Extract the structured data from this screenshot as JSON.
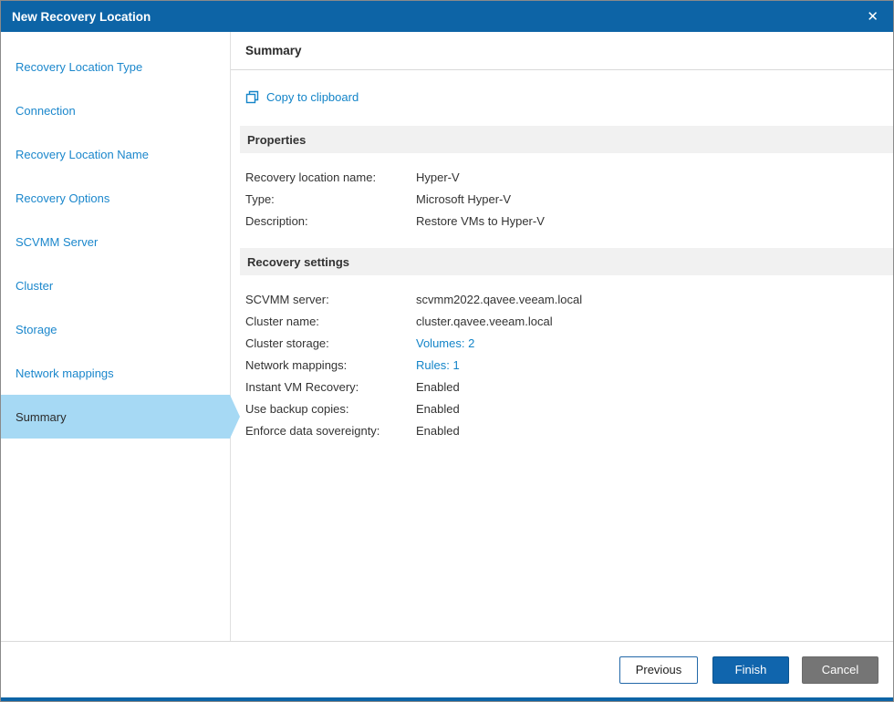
{
  "window": {
    "title": "New Recovery Location",
    "close_glyph": "✕"
  },
  "sidebar": {
    "items": [
      {
        "label": "Recovery Location Type"
      },
      {
        "label": "Connection"
      },
      {
        "label": "Recovery Location Name"
      },
      {
        "label": "Recovery Options"
      },
      {
        "label": "SCVMM Server"
      },
      {
        "label": "Cluster"
      },
      {
        "label": "Storage"
      },
      {
        "label": "Network mappings"
      },
      {
        "label": "Summary"
      }
    ],
    "active_item": "Summary"
  },
  "content": {
    "heading": "Summary",
    "copy_link": "Copy to clipboard",
    "sections": {
      "properties": {
        "title": "Properties",
        "rows": [
          {
            "label": "Recovery location name:",
            "value": "Hyper-V"
          },
          {
            "label": "Type:",
            "value": "Microsoft Hyper-V"
          },
          {
            "label": "Description:",
            "value": "Restore VMs to Hyper-V"
          }
        ]
      },
      "recovery": {
        "title": "Recovery settings",
        "rows": [
          {
            "label": "SCVMM server:",
            "value": "scvmm2022.qavee.veeam.local"
          },
          {
            "label": "Cluster name:",
            "value": "cluster.qavee.veeam.local"
          },
          {
            "label": "Cluster storage:",
            "value": "Volumes: 2",
            "link": true
          },
          {
            "label": "Network mappings:",
            "value": "Rules: 1",
            "link": true
          },
          {
            "label": "Instant VM Recovery:",
            "value": "Enabled"
          },
          {
            "label": "Use backup copies:",
            "value": "Enabled"
          },
          {
            "label": "Enforce data sovereignty:",
            "value": "Enabled"
          }
        ]
      }
    }
  },
  "footer": {
    "previous_label": "Previous",
    "finish_label": "Finish",
    "cancel_label": "Cancel"
  },
  "colors": {
    "titlebar": "#0d64a6",
    "accent_link": "#1384c8",
    "active_item_bg": "#a6d9f4",
    "primary_button": "#1065ad",
    "cancel_button": "#757575"
  }
}
